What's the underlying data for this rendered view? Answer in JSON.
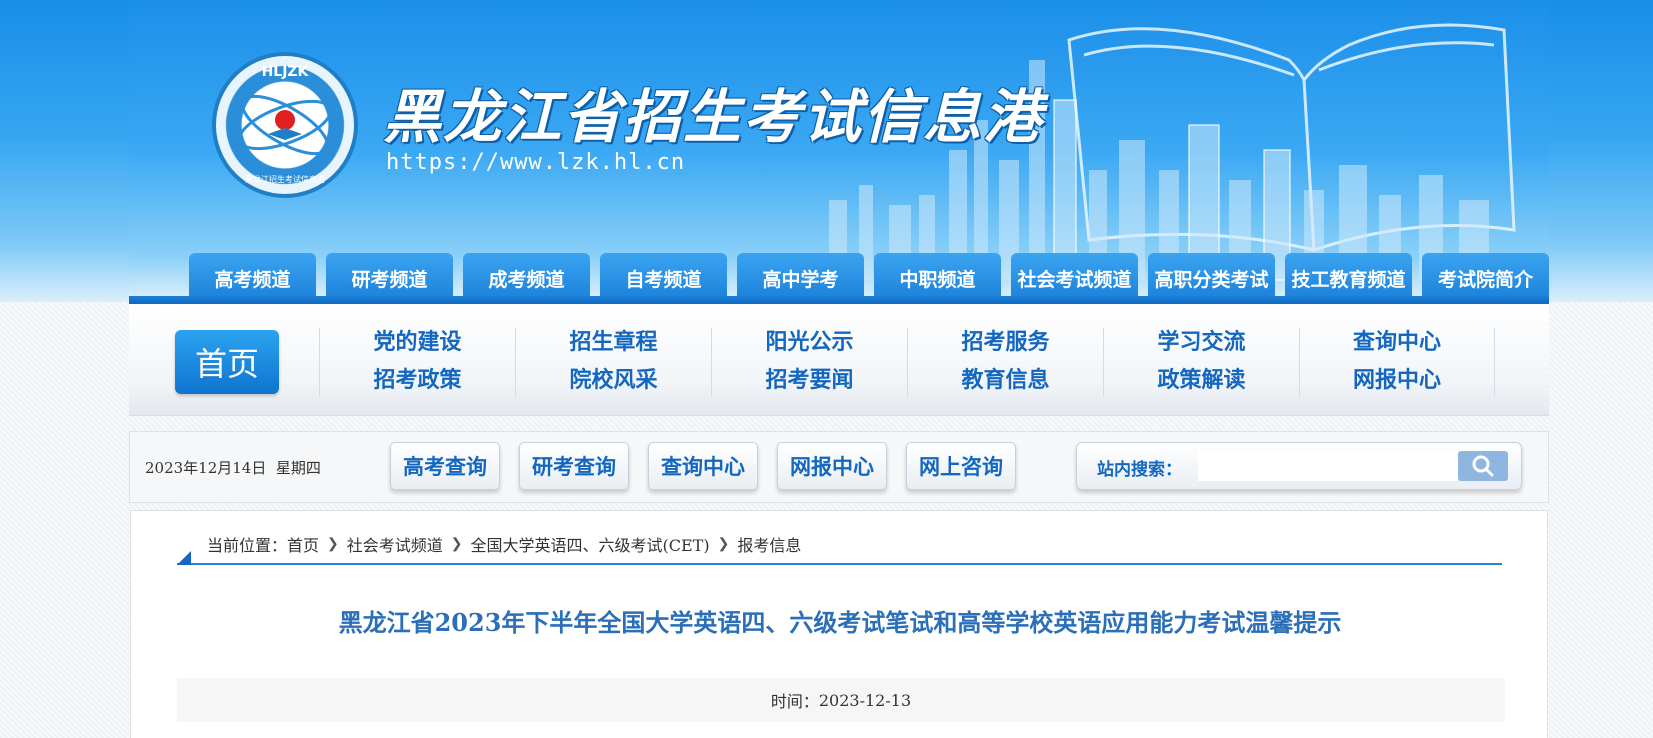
{
  "header": {
    "logo_text": "HLJZK",
    "logo_subtext": "黑龙江招生考试信息港",
    "site_title": "黑龙江省招生考试信息港",
    "site_url": "https://www.lzk.hl.cn"
  },
  "channel_tabs": [
    "高考频道",
    "研考频道",
    "成考频道",
    "自考频道",
    "高中学考",
    "中职频道",
    "社会考试频道",
    "高职分类考试",
    "技工教育频道",
    "考试院简介"
  ],
  "main_nav": {
    "home_label": "首页",
    "groups": [
      {
        "top": "党的建设",
        "bottom": "招考政策"
      },
      {
        "top": "招生章程",
        "bottom": "院校风采"
      },
      {
        "top": "阳光公示",
        "bottom": "招考要闻"
      },
      {
        "top": "招考服务",
        "bottom": "教育信息"
      },
      {
        "top": "学习交流",
        "bottom": "政策解读"
      },
      {
        "top": "查询中心",
        "bottom": "网报中心"
      }
    ]
  },
  "toolbar": {
    "date": "2023年12月14日",
    "weekday": "星期四",
    "quick_links": [
      "高考查询",
      "研考查询",
      "查询中心",
      "网报中心",
      "网上咨询"
    ],
    "search_label": "站内搜索：",
    "search_value": ""
  },
  "breadcrumb": {
    "prefix": "当前位置：",
    "items": [
      "首页",
      "社会考试频道",
      "全国大学英语四、六级考试(CET)",
      "报考信息"
    ]
  },
  "article": {
    "title": "黑龙江省2023年下半年全国大学英语四、六级考试笔试和高等学校英语应用能力考试温馨提示",
    "time_label": "时间：",
    "time_value": "2023-12-13"
  },
  "colors": {
    "brand_blue": "#1a7fd9",
    "nav_text": "#1467bf",
    "title_text": "#2a6fb8"
  }
}
